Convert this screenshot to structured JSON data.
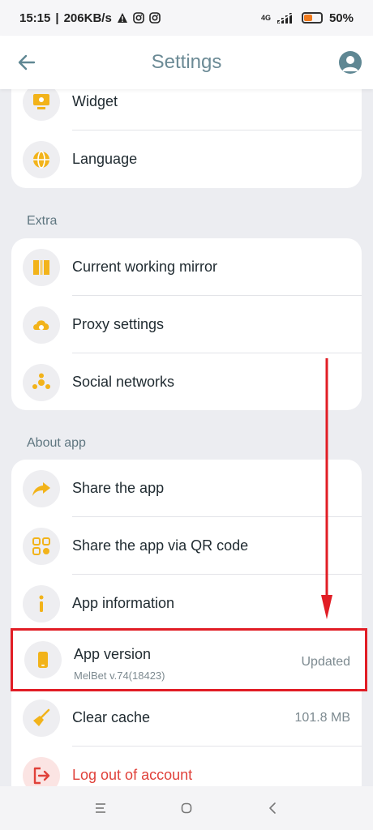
{
  "status": {
    "time": "15:15",
    "speed": "206KB/s",
    "network": "4G",
    "battery": "50%"
  },
  "appbar": {
    "title": "Settings"
  },
  "colors": {
    "accent": "#f2b31a",
    "icon_bg": "#eeeef1",
    "danger": "#e0413a",
    "highlight": "#e11d25"
  },
  "card_top": {
    "items": [
      {
        "label": "Widget",
        "icon": "widget-icon"
      },
      {
        "label": "Language",
        "icon": "globe-icon"
      }
    ]
  },
  "extra": {
    "title": "Extra",
    "items": [
      {
        "label": "Current working mirror",
        "icon": "mirror-icon"
      },
      {
        "label": "Proxy settings",
        "icon": "cloud-gear-icon"
      },
      {
        "label": "Social networks",
        "icon": "social-icon"
      }
    ]
  },
  "about": {
    "title": "About app",
    "items": [
      {
        "label": "Share the app",
        "icon": "share-arrow-icon"
      },
      {
        "label": "Share the app via QR code",
        "icon": "qr-code-icon"
      },
      {
        "label": "App information",
        "icon": "info-icon"
      }
    ],
    "version": {
      "label": "App version",
      "sub": "MelBet v.74(18423)",
      "value": "Updated",
      "icon": "phone-icon"
    },
    "cache": {
      "label": "Clear cache",
      "value": "101.8 MB",
      "icon": "broom-icon"
    },
    "logout": {
      "label": "Log out of account",
      "icon": "logout-icon"
    }
  }
}
